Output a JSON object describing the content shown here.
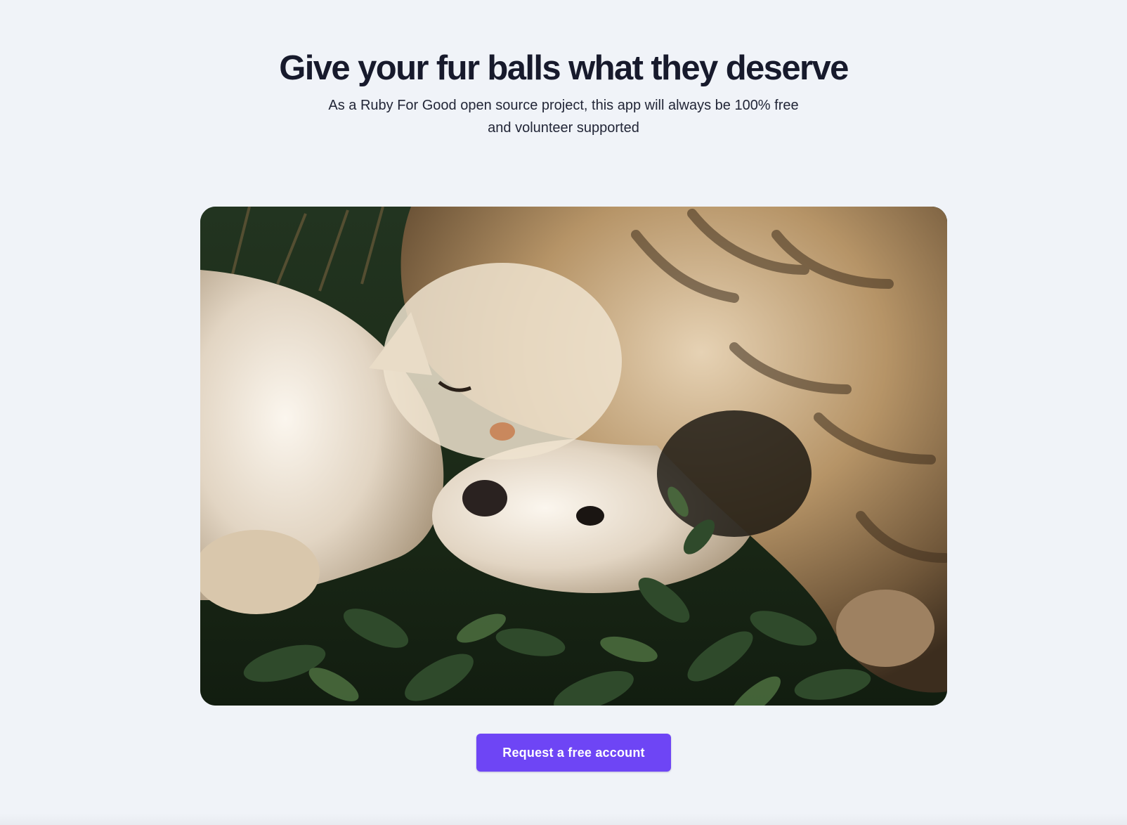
{
  "hero": {
    "title": "Give your fur balls what they deserve",
    "subtitle": "As a Ruby For Good open source project, this app will always be 100% free and volunteer supported"
  },
  "photo": {
    "icon": "cat-and-dog-photo"
  },
  "cta": {
    "label": "Request a free account",
    "color": "#6e45f5"
  },
  "colors": {
    "background": "#f0f3f8",
    "heading": "#171a2c"
  }
}
